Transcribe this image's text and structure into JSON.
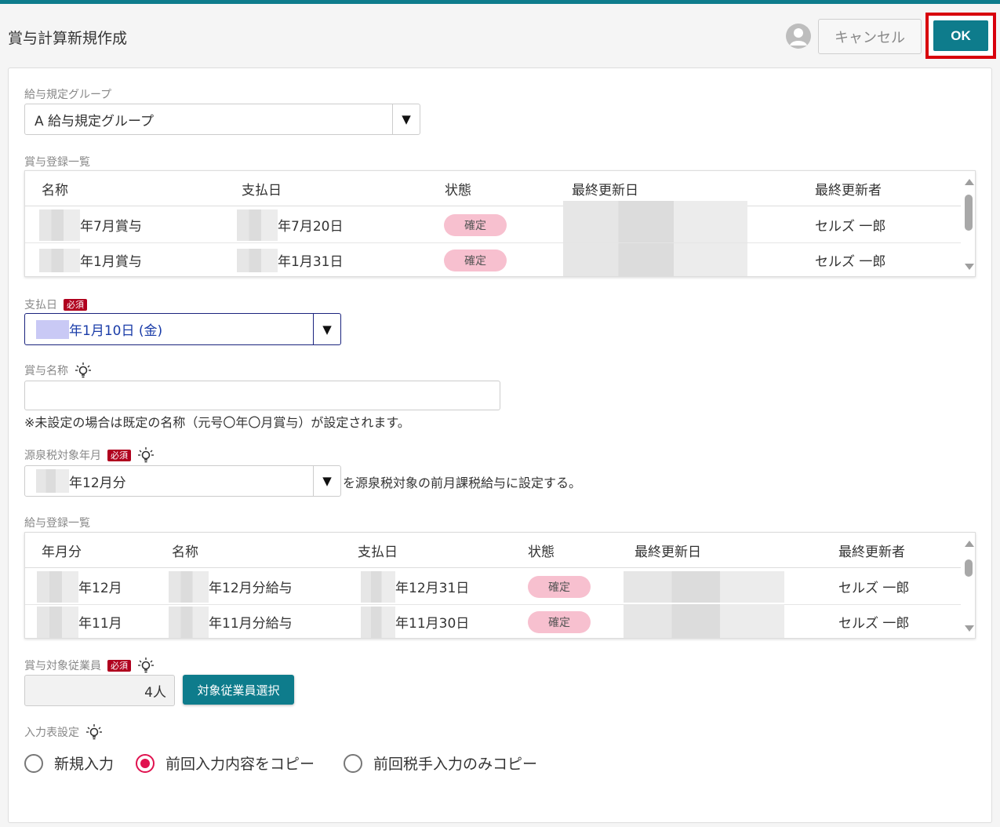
{
  "header": {
    "title": "賞与計算新規作成",
    "cancel_label": "キャンセル",
    "ok_label": "OK",
    "accent_color": "#0e7c8c"
  },
  "group": {
    "label": "給与規定グループ",
    "value": "A 給与規定グループ"
  },
  "bonus_list": {
    "label": "賞与登録一覧",
    "columns": [
      "名称",
      "支払日",
      "状態",
      "最終更新日",
      "最終更新者"
    ],
    "rows": [
      {
        "name": "年7月賞与",
        "pay_date": "年7月20日",
        "status": "確定",
        "updated_by": "セルズ 一郎"
      },
      {
        "name": "年1月賞与",
        "pay_date": "年1月31日",
        "status": "確定",
        "updated_by": "セルズ 一郎"
      }
    ]
  },
  "pay_date": {
    "label": "支払日",
    "required": "必須",
    "value": "年1月10日 (金)"
  },
  "bonus_name": {
    "label": "賞与名称",
    "value": "",
    "note": "※未設定の場合は既定の名称（元号〇年〇月賞与）が設定されます。"
  },
  "tax_month": {
    "label": "源泉税対象年月",
    "required": "必須",
    "value": "年12月分",
    "suffix": "を源泉税対象の前月課税給与に設定する。"
  },
  "salary_list": {
    "label": "給与登録一覧",
    "columns": [
      "年月分",
      "名称",
      "支払日",
      "状態",
      "最終更新日",
      "最終更新者"
    ],
    "rows": [
      {
        "month": "年12月",
        "name": "年12月分給与",
        "pay_date": "年12月31日",
        "status": "確定",
        "updated_by": "セルズ 一郎"
      },
      {
        "month": "年11月",
        "name": "年11月分給与",
        "pay_date": "年11月30日",
        "status": "確定",
        "updated_by": "セルズ 一郎"
      }
    ]
  },
  "employees": {
    "label": "賞与対象従業員",
    "required": "必須",
    "count": "4人",
    "select_label": "対象従業員選択"
  },
  "input_setting": {
    "label": "入力表設定",
    "options": [
      "新規入力",
      "前回入力内容をコピー",
      "前回税手入力のみコピー"
    ],
    "selected": "前回入力内容をコピー"
  }
}
